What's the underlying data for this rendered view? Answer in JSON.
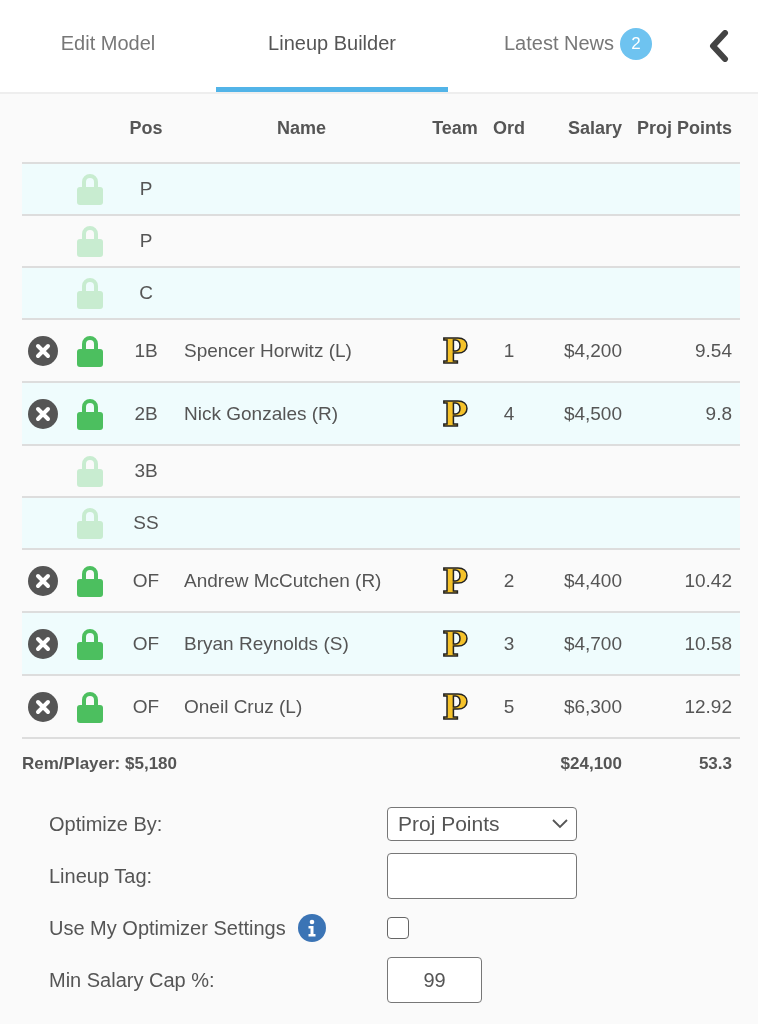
{
  "tabs": [
    {
      "label": "Edit Model",
      "selected": false
    },
    {
      "label": "Lineup Builder",
      "selected": true
    },
    {
      "label": "Latest News",
      "selected": false,
      "badge": "2"
    }
  ],
  "table": {
    "columns": [
      "Pos",
      "Name",
      "Team",
      "Ord",
      "Salary",
      "Proj Points"
    ],
    "rows": [
      {
        "pos": "P",
        "locked": false
      },
      {
        "pos": "P",
        "locked": false
      },
      {
        "pos": "C",
        "locked": false
      },
      {
        "pos": "1B",
        "locked": true,
        "name": "Spencer Horwitz (L)",
        "team": "P",
        "ord": "1",
        "salary": "$4,200",
        "proj": "9.54"
      },
      {
        "pos": "2B",
        "locked": true,
        "name": "Nick Gonzales (R)",
        "team": "P",
        "ord": "4",
        "salary": "$4,500",
        "proj": "9.8"
      },
      {
        "pos": "3B",
        "locked": false
      },
      {
        "pos": "SS",
        "locked": false
      },
      {
        "pos": "OF",
        "locked": true,
        "name": "Andrew McCutchen (R)",
        "team": "P",
        "ord": "2",
        "salary": "$4,400",
        "proj": "10.42"
      },
      {
        "pos": "OF",
        "locked": true,
        "name": "Bryan Reynolds (S)",
        "team": "P",
        "ord": "3",
        "salary": "$4,700",
        "proj": "10.58"
      },
      {
        "pos": "OF",
        "locked": true,
        "name": "Oneil Cruz (L)",
        "team": "P",
        "ord": "5",
        "salary": "$6,300",
        "proj": "12.92"
      }
    ],
    "totals": {
      "remaining": "Rem/Player: $5,180",
      "salary": "$24,100",
      "proj": "53.3"
    }
  },
  "form": [
    {
      "kind": "select",
      "label": "Optimize By:",
      "value": "Proj Points"
    },
    {
      "kind": "text",
      "label": "Lineup Tag:"
    },
    {
      "kind": "checkbox",
      "label": "Use My Optimizer Settings",
      "info": true,
      "checked": false
    },
    {
      "kind": "number",
      "label": "Min Salary Cap %:",
      "value": "99"
    }
  ]
}
